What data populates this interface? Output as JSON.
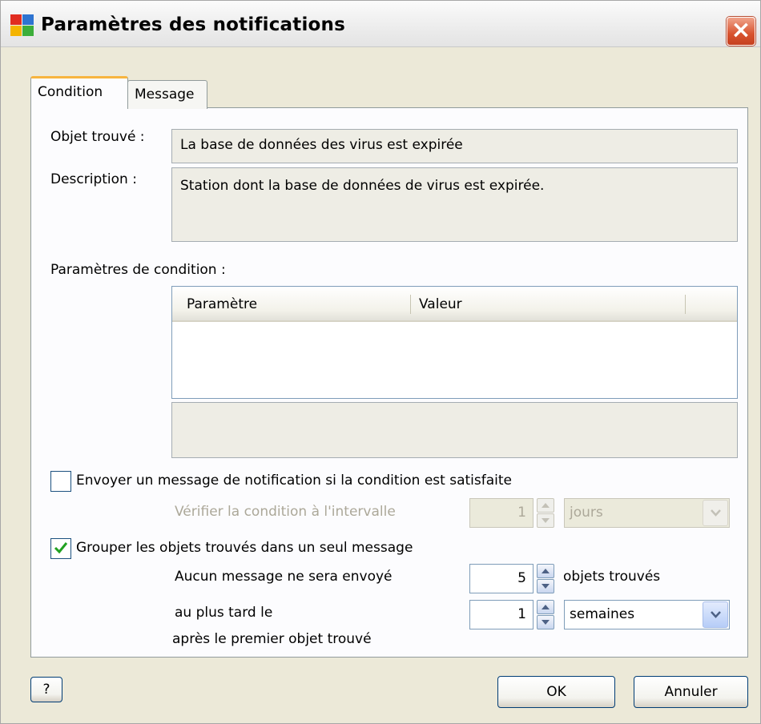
{
  "window": {
    "title": "Paramètres des notifications",
    "close_label": "×"
  },
  "tabs": [
    {
      "label": "Condition",
      "active": true
    },
    {
      "label": "Message",
      "active": false
    }
  ],
  "condition": {
    "found_object_label": "Objet trouvé :",
    "found_object_value": "La base de données des virus est expirée",
    "description_label": "Description :",
    "description_value": "Station dont la base de données de virus est expirée.",
    "params_label": "Paramètres de condition :",
    "table": {
      "columns": [
        "Paramètre",
        "Valeur"
      ],
      "rows": []
    },
    "send_checkbox": {
      "label": "Envoyer un message de notification si la condition est satisfaite",
      "checked": false
    },
    "check_interval": {
      "label": "Vérifier la condition à l'intervalle",
      "value": "1",
      "unit": "jours",
      "enabled": false
    },
    "group_checkbox": {
      "label": "Grouper les objets trouvés dans un seul message",
      "checked": true
    },
    "no_message_label": "Aucun message ne sera envoyé",
    "objects_count": "5",
    "objects_suffix": "objets trouvés",
    "latest_label": "au plus tard le",
    "latest_value": "1",
    "latest_unit": "semaines",
    "after_label": "après le premier objet trouvé"
  },
  "buttons": {
    "help": "?",
    "ok": "OK",
    "cancel": "Annuler"
  },
  "colors": {
    "dialog_bg": "#ece9d8",
    "tab_accent": "#f7b53f",
    "close_red": "#d8532f",
    "check_green": "#21a121"
  }
}
